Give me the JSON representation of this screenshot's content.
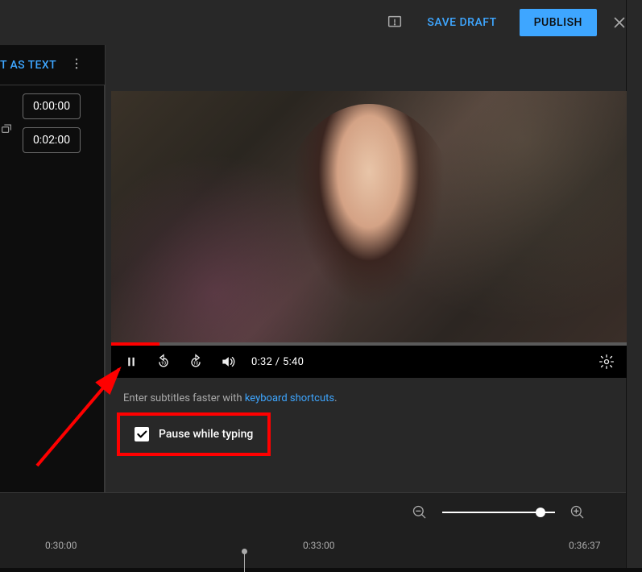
{
  "topbar": {
    "save_draft": "SAVE DRAFT",
    "publish": "PUBLISH"
  },
  "subbar": {
    "as_text": "T AS TEXT"
  },
  "timestamps": {
    "start": "0:00:00",
    "end": "0:02:00"
  },
  "player": {
    "current_time": "0:32",
    "total_time": "5:40",
    "progress_pct": 9.4
  },
  "hint": {
    "prefix": "Enter subtitles faster with ",
    "link_text": "keyboard shortcuts",
    "suffix": "."
  },
  "pause_while_typing": {
    "label": "Pause while typing",
    "checked": true
  },
  "timeline": {
    "ticks": [
      "0:30:00",
      "0:33:00",
      "0:36:37"
    ],
    "playhead_position_pct": 35
  }
}
